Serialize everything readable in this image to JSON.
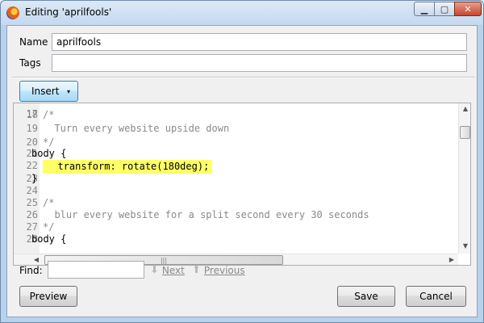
{
  "window": {
    "title": "Editing 'aprilfools'",
    "controls": {
      "minimize": "▁",
      "maximize": "▢",
      "close": "✕"
    }
  },
  "form": {
    "name_label": "Name",
    "name_value": "aprilfools",
    "tags_label": "Tags",
    "tags_value": ""
  },
  "toolbar": {
    "insert_label": "Insert",
    "insert_arrow": "▾"
  },
  "editor": {
    "partial_top_number": "17",
    "lines": [
      {
        "n": "18",
        "text": "/*"
      },
      {
        "n": "19",
        "text": "  Turn every website upside down"
      },
      {
        "n": "20",
        "text": "*/"
      },
      {
        "n": "21",
        "text": "body {"
      },
      {
        "n": "22",
        "text": "  transform: rotate(180deg);"
      },
      {
        "n": "23",
        "text": "}"
      },
      {
        "n": "24",
        "text": ""
      },
      {
        "n": "25",
        "text": "/*"
      },
      {
        "n": "26",
        "text": "  blur every website for a split second every 30 seconds"
      },
      {
        "n": "27",
        "text": "*/"
      },
      {
        "n": "28",
        "text": "body {"
      }
    ],
    "highlighted_line": "22",
    "highlight_color": "#ffff66",
    "comment_color": "#8a8a8a",
    "scroll_up": "▲",
    "scroll_down": "▼",
    "scroll_left": "◀",
    "scroll_right": "▶",
    "grip": "|||"
  },
  "find": {
    "label": "Find:",
    "value": "",
    "next_label": "Next",
    "previous_label": "Previous",
    "next_icon": "arrow-down-icon",
    "previous_icon": "arrow-up-icon"
  },
  "buttons": {
    "preview": "Preview",
    "save": "Save",
    "cancel": "Cancel"
  }
}
